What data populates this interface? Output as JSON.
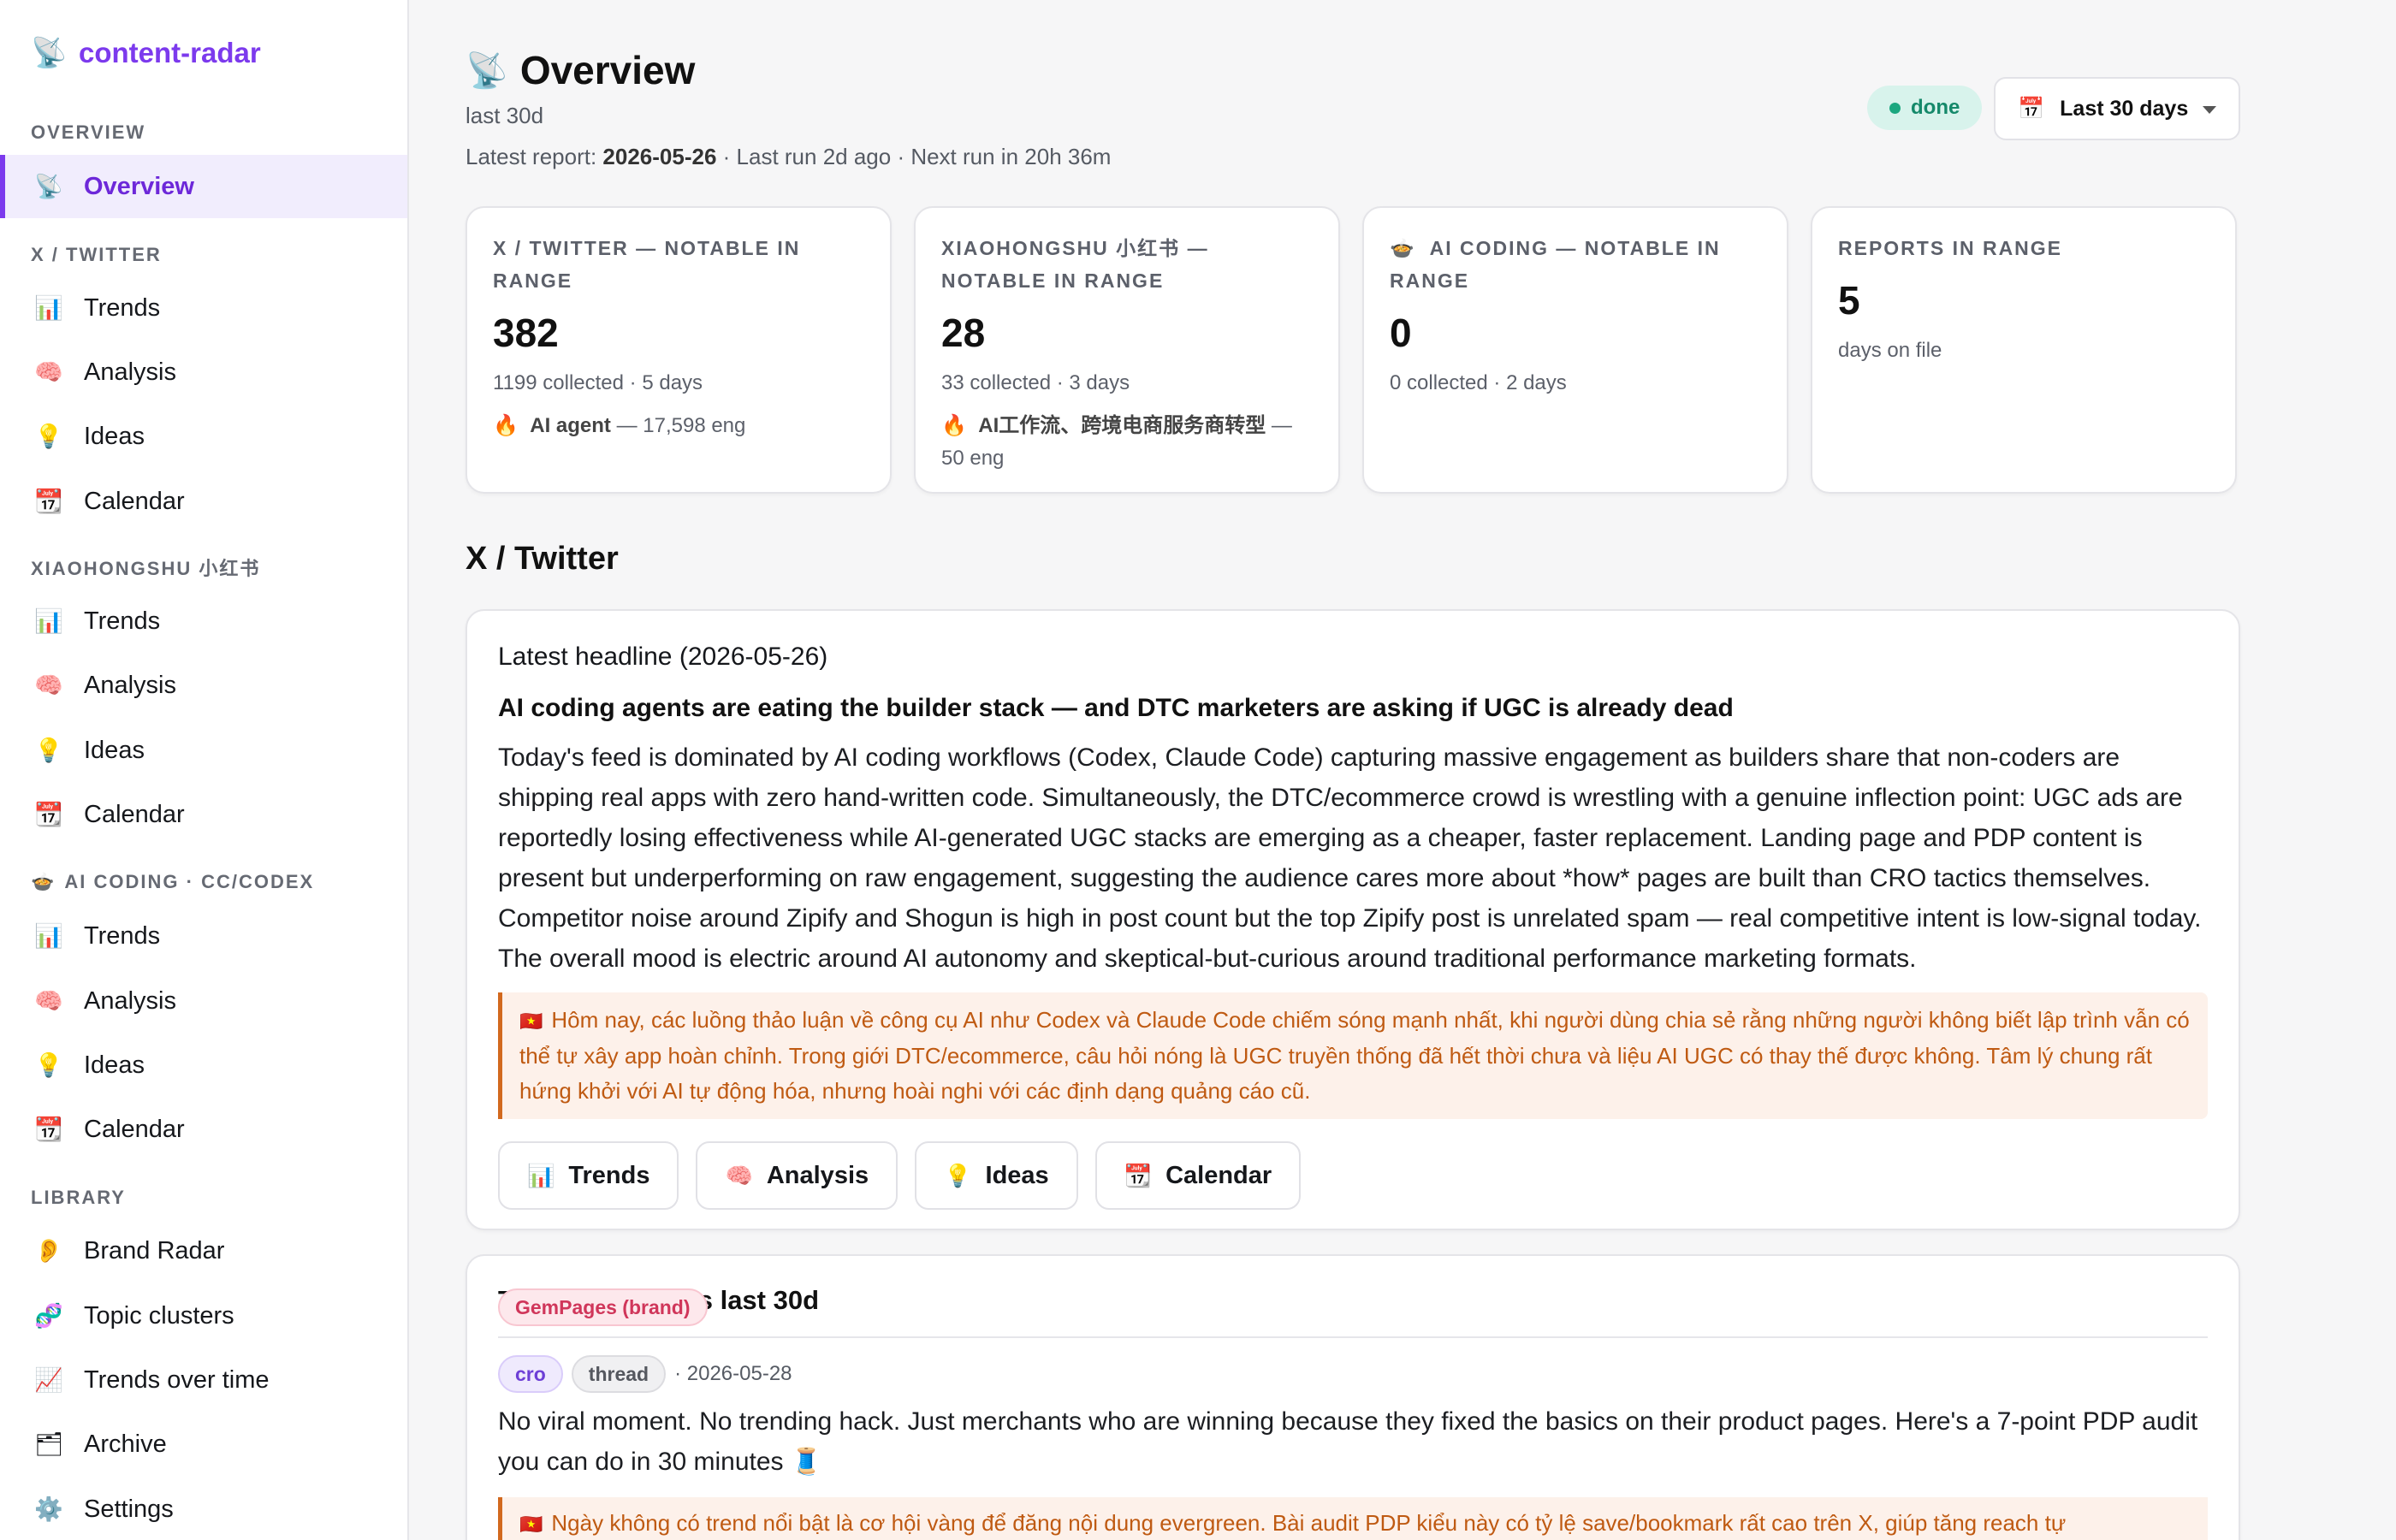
{
  "brand": {
    "icon": "📡",
    "name": "content-radar"
  },
  "sidebar": {
    "overview_label": "OVERVIEW",
    "overview_item": {
      "icon": "📡",
      "label": "Overview"
    },
    "twitter_label": "X / TWITTER",
    "twitter_items": [
      {
        "icon": "📊",
        "label": "Trends"
      },
      {
        "icon": "🧠",
        "label": "Analysis"
      },
      {
        "icon": "💡",
        "label": "Ideas"
      },
      {
        "icon": "📆",
        "label": "Calendar"
      }
    ],
    "xhs_label": "XIAOHONGSHU 小红书",
    "xhs_items": [
      {
        "icon": "📊",
        "label": "Trends"
      },
      {
        "icon": "🧠",
        "label": "Analysis"
      },
      {
        "icon": "💡",
        "label": "Ideas"
      },
      {
        "icon": "📆",
        "label": "Calendar"
      }
    ],
    "ai_label_icon": "🍲",
    "ai_label": "AI CODING · CC/CODEX",
    "ai_items": [
      {
        "icon": "📊",
        "label": "Trends"
      },
      {
        "icon": "🧠",
        "label": "Analysis"
      },
      {
        "icon": "💡",
        "label": "Ideas"
      },
      {
        "icon": "📆",
        "label": "Calendar"
      }
    ],
    "library_label": "LIBRARY",
    "library_items": [
      {
        "icon": "👂",
        "label": "Brand Radar"
      },
      {
        "icon": "🧬",
        "label": "Topic clusters"
      },
      {
        "icon": "📈",
        "label": "Trends over time"
      },
      {
        "icon": "🗂",
        "label": "Archive"
      },
      {
        "icon": "⚙️",
        "label": "Settings"
      }
    ]
  },
  "header": {
    "title_icon": "📡",
    "title": "Overview",
    "subtitle": "last 30d",
    "latest_prefix": "Latest report: ",
    "latest_date": "2026-05-26",
    "run_info": " · Last run 2d ago · Next run in 20h 36m",
    "status": "done",
    "range_icon": "📅",
    "range": "Last 30 days"
  },
  "stats": [
    {
      "label": "X / TWITTER — NOTABLE IN RANGE",
      "value": "382",
      "meta": "1199 collected · 5 days",
      "hot_icon": "🔥",
      "hot_topic": "AI agent",
      "hot_rest": " — 17,598 eng"
    },
    {
      "label": "XIAOHONGSHU 小红书 — NOTABLE IN RANGE",
      "value": "28",
      "meta": "33 collected · 3 days",
      "hot_icon": "🔥",
      "hot_topic": "AI工作流、跨境电商服务商转型",
      "hot_rest": " — 50 eng"
    },
    {
      "label_icon": "🍲",
      "label": "AI CODING — NOTABLE IN RANGE",
      "value": "0",
      "meta": "0 collected · 2 days"
    },
    {
      "label": "REPORTS IN RANGE",
      "value": "5",
      "meta": "days on file"
    }
  ],
  "section": {
    "title": "X / Twitter"
  },
  "headline": {
    "date_line": "Latest headline (2026-05-26)",
    "title": "AI coding agents are eating the builder stack — and DTC marketers are asking if UGC is already dead",
    "body": "Today's feed is dominated by AI coding workflows (Codex, Claude Code) capturing massive engagement as builders share that non-coders are shipping real apps with zero hand-written code. Simultaneously, the DTC/ecommerce crowd is wrestling with a genuine inflection point: UGC ads are reportedly losing effectiveness while AI-generated UGC stacks are emerging as a cheaper, faster replacement. Landing page and PDP content is present but underperforming on raw engagement, suggesting the audience cares more about *how* pages are built than CRO tactics themselves. Competitor noise around Zipify and Shogun is high in post count but the top Zipify post is unrelated spam — real competitive intent is low-signal today. The overall mood is electric around AI autonomy and skeptical-but-curious around traditional performance marketing formats.",
    "vn_flag": "🇻🇳",
    "vn_text": "Hôm nay, các luồng thảo luận về công cụ AI như Codex và Claude Code chiếm sóng mạnh nhất, khi người dùng chia sẻ rằng những người không biết lập trình vẫn có thể tự xây app hoàn chỉnh. Trong giới DTC/ecommerce, câu hỏi nóng là UGC truyền thống đã hết thời chưa và liệu AI UGC có thay thế được không. Tâm lý chung rất hứng khởi với AI tự động hóa, nhưng hoài nghi với các định dạng quảng cáo cũ.",
    "buttons": [
      {
        "icon": "📊",
        "label": "Trends"
      },
      {
        "icon": "🧠",
        "label": "Analysis"
      },
      {
        "icon": "💡",
        "label": "Ideas"
      },
      {
        "icon": "📆",
        "label": "Calendar"
      }
    ]
  },
  "picks": {
    "title": "Top picks across last 30d",
    "tags": [
      "GemPages (brand)",
      "cro",
      "thread"
    ],
    "date": "· 2026-05-28",
    "text": "No viral moment. No trending hack. Just merchants who are winning because they fixed the basics on their product pages. Here's a 7-point PDP audit you can do in 30 minutes 🧵",
    "vn_flag": "🇻🇳",
    "vn_text": "Ngày không có trend nổi bật là cơ hội vàng để đăng nội dung evergreen. Bài audit PDP kiểu này có tỷ lệ save/bookmark rất cao trên X, giúp tăng reach tự"
  }
}
